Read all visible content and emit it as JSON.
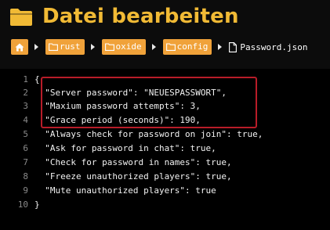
{
  "page_title": "Datei bearbeiten",
  "breadcrumb": {
    "home_icon": "home-icon",
    "folders": [
      "rust",
      "oxide",
      "config"
    ],
    "file": "Password.json"
  },
  "editor": {
    "line_numbers": [
      "1",
      "2",
      "3",
      "4",
      "5",
      "6",
      "7",
      "8",
      "9",
      "10"
    ],
    "lines": [
      "{",
      "  \"Server password\": \"NEUESPASSWORT\",",
      "  \"Maxium password attempts\": 3,",
      "  \"Grace period (seconds)\": 190,",
      "  \"Always check for password on join\": true,",
      "  \"Ask for password in chat\": true,",
      "  \"Check for password in names\": true,",
      "  \"Freeze unauthorized players\": true,",
      "  \"Mute unauthorized players\": true",
      "}"
    ]
  },
  "colors": {
    "title": "#f1ba35",
    "accent": "#f0a23a",
    "highlight_border": "#b81c28",
    "background": "#0c0c0c",
    "editor_background": "#000000"
  }
}
